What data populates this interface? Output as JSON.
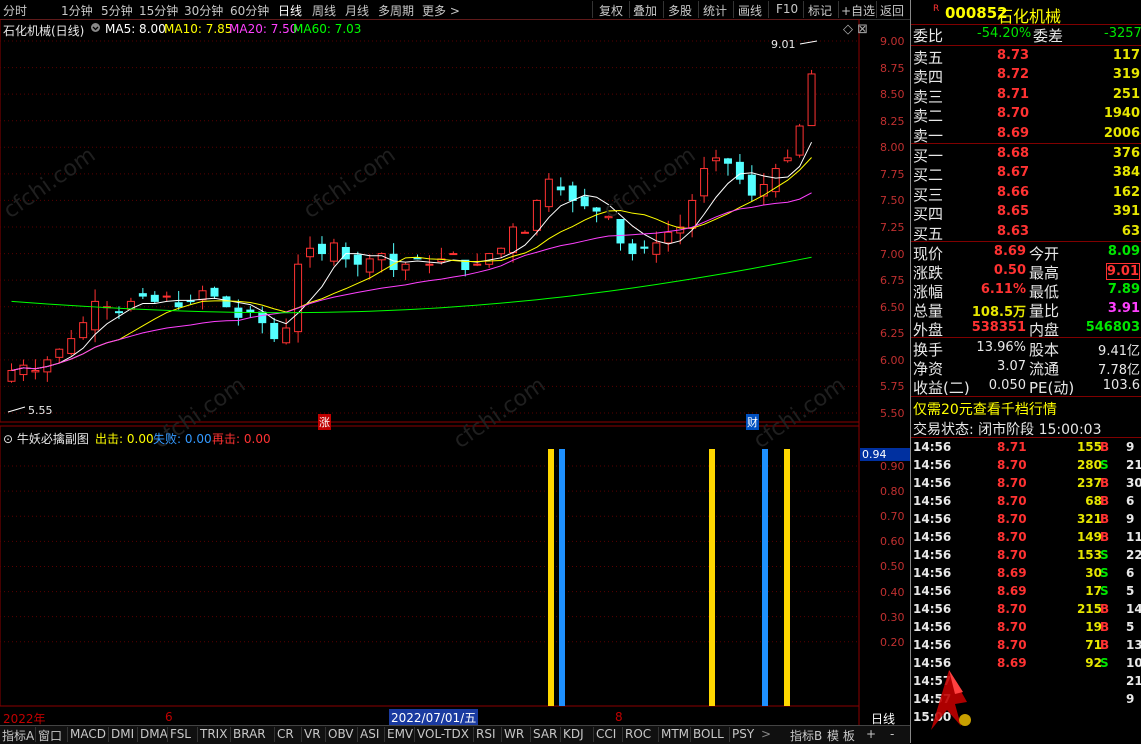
{
  "toolbar": {
    "periods": [
      "分时",
      "1分钟",
      "5分钟",
      "15分钟",
      "30分钟",
      "60分钟",
      "日线",
      "周线",
      "月线",
      "多周期",
      "更多"
    ],
    "active_period": "日线",
    "tools": [
      "复权",
      "叠加",
      "多股",
      "统计",
      "画线",
      "F10",
      "标记",
      "+自选",
      "返回"
    ]
  },
  "main_chart": {
    "name": "石化机械(日线)",
    "ma_labels": [
      "MA5: 8.00",
      "MA10: 7.85",
      "MA20: 7.50",
      "MA60: 7.03"
    ],
    "ma_colors": [
      "#ffffff",
      "#ffff00",
      "#ff00ff",
      "#00ff00"
    ],
    "y_ticks": [
      "9.00",
      "8.75",
      "8.50",
      "8.25",
      "8.00",
      "7.75",
      "7.50",
      "7.25",
      "7.00",
      "6.75",
      "6.50",
      "6.25",
      "6.00",
      "5.75",
      "5.50"
    ],
    "high_mark": "9.01",
    "low_mark": "5.55",
    "event_zhang": "涨",
    "event_cai": "财"
  },
  "sub_chart": {
    "name": "牛妖必擒副图",
    "legend": [
      {
        "label": "出击:",
        "value": "0.00",
        "color": "#ffff00"
      },
      {
        "label": "失败:",
        "value": "0.00",
        "color": "#3399ff"
      },
      {
        "label": "再击:",
        "value": "0.00",
        "color": "#ff3232"
      }
    ],
    "y_ticks": [
      "0.90",
      "0.80",
      "0.70",
      "0.60",
      "0.50",
      "0.40",
      "0.30",
      "0.20"
    ],
    "current_value": "0.94"
  },
  "x_axis": {
    "labels": [
      "2022年",
      "6",
      "2022/07/01/五",
      "8"
    ],
    "period_label": "日线"
  },
  "bottom_tabs": [
    "指标A",
    "窗口",
    "MACD",
    "DMI",
    "DMA",
    "FSL",
    "TRIX",
    "BRAR",
    "CR",
    "VR",
    "OBV",
    "ASI",
    "EMV",
    "VOL-TDX",
    "RSI",
    "WR",
    "SAR",
    "KDJ",
    "CCI",
    "ROC",
    "MTM",
    "BOLL",
    "PSY"
  ],
  "bottom_right_tabs": [
    "指标B",
    "模 板",
    "+",
    "-"
  ],
  "quote": {
    "code": "000852",
    "name": "石化机械",
    "weibi_label": "委比",
    "weibi": "-54.20%",
    "weicha_label": "委差",
    "weicha": "-3257",
    "asks": [
      {
        "label": "卖五",
        "price": "8.73",
        "vol": "117"
      },
      {
        "label": "卖四",
        "price": "8.72",
        "vol": "319"
      },
      {
        "label": "卖三",
        "price": "8.71",
        "vol": "251"
      },
      {
        "label": "卖二",
        "price": "8.70",
        "vol": "1940"
      },
      {
        "label": "卖一",
        "price": "8.69",
        "vol": "2006"
      }
    ],
    "bids": [
      {
        "label": "买一",
        "price": "8.68",
        "vol": "376"
      },
      {
        "label": "买二",
        "price": "8.67",
        "vol": "384"
      },
      {
        "label": "买三",
        "price": "8.66",
        "vol": "162"
      },
      {
        "label": "买四",
        "price": "8.65",
        "vol": "391"
      },
      {
        "label": "买五",
        "price": "8.63",
        "vol": "63"
      }
    ],
    "stats": [
      {
        "l1": "现价",
        "v1": "8.69",
        "c1": "red",
        "l2": "今开",
        "v2": "8.09",
        "c2": "green"
      },
      {
        "l1": "涨跌",
        "v1": "0.50",
        "c1": "red",
        "l2": "最高",
        "v2": "9.01",
        "c2": "red"
      },
      {
        "l1": "涨幅",
        "v1": "6.11%",
        "c1": "red",
        "l2": "最低",
        "v2": "7.89",
        "c2": "green"
      },
      {
        "l1": "总量",
        "v1": "108.5万",
        "c1": "yellow",
        "l2": "量比",
        "v2": "3.91",
        "c2": "magenta"
      },
      {
        "l1": "外盘",
        "v1": "538351",
        "c1": "red",
        "l2": "内盘",
        "v2": "546803",
        "c2": "green"
      }
    ],
    "stats2": [
      {
        "l1": "换手",
        "v1": "13.96%",
        "l2": "股本",
        "v2": "9.41亿"
      },
      {
        "l1": "净资",
        "v1": "3.07",
        "l2": "流通",
        "v2": "7.78亿"
      },
      {
        "l1": "收益(二)",
        "v1": "0.050",
        "l2": "PE(动)",
        "v2": "103.6"
      }
    ],
    "promo": "仅需20元查看千档行情",
    "trade_state": "交易状态: 闭市阶段 15:00:03",
    "ticks": [
      {
        "t": "14:56",
        "p": "8.71",
        "v": "155",
        "s": "B",
        "n": "9"
      },
      {
        "t": "14:56",
        "p": "8.70",
        "v": "280",
        "s": "S",
        "n": "21"
      },
      {
        "t": "14:56",
        "p": "8.70",
        "v": "237",
        "s": "B",
        "n": "30"
      },
      {
        "t": "14:56",
        "p": "8.70",
        "v": "68",
        "s": "B",
        "n": "6"
      },
      {
        "t": "14:56",
        "p": "8.70",
        "v": "321",
        "s": "B",
        "n": "9"
      },
      {
        "t": "14:56",
        "p": "8.70",
        "v": "149",
        "s": "B",
        "n": "11"
      },
      {
        "t": "14:56",
        "p": "8.70",
        "v": "153",
        "s": "S",
        "n": "22"
      },
      {
        "t": "14:56",
        "p": "8.69",
        "v": "30",
        "s": "S",
        "n": "6"
      },
      {
        "t": "14:56",
        "p": "8.69",
        "v": "17",
        "s": "S",
        "n": "5"
      },
      {
        "t": "14:56",
        "p": "8.70",
        "v": "215",
        "s": "B",
        "n": "14"
      },
      {
        "t": "14:56",
        "p": "8.70",
        "v": "19",
        "s": "B",
        "n": "5"
      },
      {
        "t": "14:56",
        "p": "8.70",
        "v": "71",
        "s": "B",
        "n": "13"
      },
      {
        "t": "14:56",
        "p": "8.69",
        "v": "92",
        "s": "S",
        "n": "10"
      },
      {
        "t": "14:57",
        "p": "",
        "v": "",
        "s": "",
        "n": "21"
      },
      {
        "t": "14:57",
        "p": "",
        "v": "",
        "s": "",
        "n": "9"
      },
      {
        "t": "15:00",
        "p": "",
        "v": "",
        "s": "",
        "n": ""
      }
    ]
  }
}
